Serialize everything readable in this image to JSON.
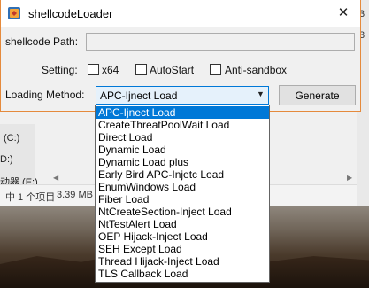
{
  "window": {
    "title": "shellcodeLoader",
    "close_glyph": "✕"
  },
  "form": {
    "path_label": "shellcode Path:",
    "path_value": "",
    "setting_label": "Setting:",
    "options": [
      {
        "label": "x64",
        "checked": false
      },
      {
        "label": "AutoStart",
        "checked": false
      },
      {
        "label": "Anti-sandbox",
        "checked": false
      }
    ],
    "method_label": "Loading Method:",
    "method_selected": "APC-Ijnect Load",
    "generate_label": "Generate"
  },
  "dropdown": {
    "items": [
      "APC-Ijnect Load",
      "CreateThreatPoolWait Load",
      "Direct Load",
      "Dynamic Load",
      "Dynamic Load plus",
      "Early Bird APC-Injetc Load",
      "EnumWindows Load",
      "Fiber Load",
      "NtCreateSection-Inject Load",
      "NtTestAlert Load",
      "OEP Hijack-Inject Load",
      "SEH Except Load",
      "Thread Hijack-Inject Load",
      "TLS Callback Load"
    ],
    "selected_index": 0
  },
  "background": {
    "drive_c": "(C:)",
    "drive_d": "D:)",
    "drive_e": "动器 (E:)",
    "status_items": "中 1 个项目",
    "status_size": "3.39 MB",
    "right_num_1": "3",
    "right_num_2": "3"
  },
  "colors": {
    "accent": "#0078d7",
    "window_border": "#e58a3c",
    "selected_bg": "#0078d7"
  }
}
